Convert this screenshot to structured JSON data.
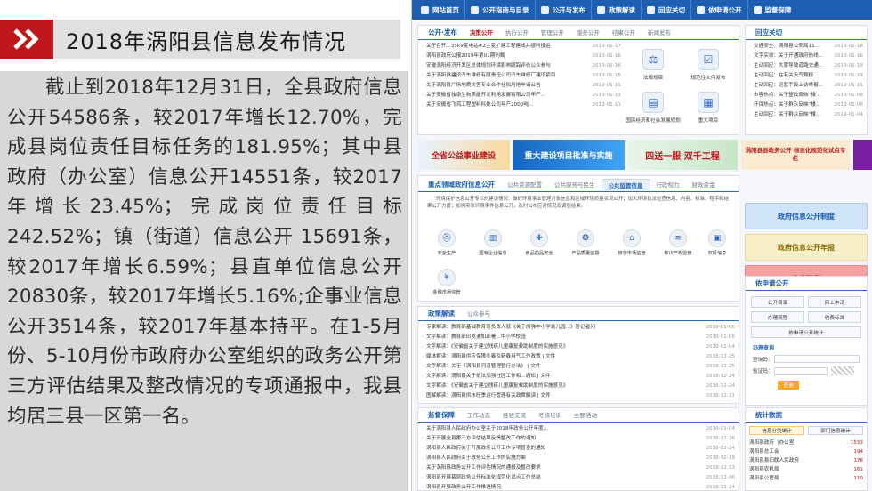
{
  "slide": {
    "title": "2018年涡阳县信息发布情况",
    "body": "截止到2018年12月31日，全县政府信息公开54586条，较2017年增长12.70%，完成县岗位责任目标任务的181.95%；其中县政府（办公室）信息公开14551条，较2017年增长23.45%；完成岗位责任目标242.52%；镇（街道）信息公开 15691条，较2017年增长6.59%；县直单位信息公开20830条，较2017年增长5.16%;企事业信息公开3514条，较2017年基本持平。在1-5月份、5-10月份市政府办公室组织的政务公开第三方评估结果及整改情况的专项通报中，我县均居三县一区第一名。"
  },
  "web": {
    "nav": [
      "网站首页",
      "公开指南与目录",
      "公开与发布",
      "政策解读",
      "回应关切",
      "依申请公开",
      "监督保障"
    ],
    "publish": {
      "tabs": [
        "公开·发布",
        "决策公开",
        "执行公开",
        "管理公开",
        "服务公开",
        "结果公开",
        "新闻发布"
      ],
      "items": [
        {
          "t": "关于召开...35kV变电站#2主变扩建工程建成并顺利投运",
          "d": "2019-01-17"
        },
        {
          "t": "涡阳县政府公报2019年第01期刊载",
          "d": "2019-01-16"
        },
        {
          "t": "安徽涡阳经济开发区总体规划环境影响跟踪评价公众参与",
          "d": "2019-01-16"
        },
        {
          "t": "关于涡阳县建设汽车维修有限责任公司汽车维修厂建设项目",
          "d": "2019-01-15"
        },
        {
          "t": "关于涡阳县广场地质灾害专业合作社拟用地申请公告",
          "d": "2019-01-11"
        },
        {
          "t": "关于安徽省独墩生物质能开发利用发展有限公司年产...",
          "d": "2019-01-11"
        },
        {
          "t": "关于安徽省飞鸿工程塑料科技公司年产2000吨...",
          "d": "2019-01-11"
        }
      ],
      "icons": [
        "法规规章",
        "规范性文件发布",
        "国民经济和社会发展规划",
        "重大项目"
      ]
    },
    "respond": {
      "title": "回应关切",
      "items": [
        {
          "t": "交通安全：涡阳县公安局11...",
          "d": "2019-01-18"
        },
        {
          "t": "文字实录：关于开通政府热线...",
          "d": "2019-01-16"
        },
        {
          "t": "主动回应：大雾导致道路交通...",
          "d": "2019-01-13"
        },
        {
          "t": "主动回应：在有关天气预报...",
          "d": "2019-01-13"
        },
        {
          "t": "主动回应：运营手段上访举报...",
          "d": "2019-01-11"
        },
        {
          "t": "市容热点：关于整改反映“楼...",
          "d": "2019-01-08"
        },
        {
          "t": "环保热点：关于群众反映“楼...",
          "d": "2019-01-08"
        },
        {
          "t": "主动回应：关于群众反映“楼...",
          "d": "2019-01-04"
        }
      ]
    },
    "banners": [
      "全省公益事业建设",
      "重大建设项目批准与实施",
      "四送一服 双千工程",
      "涡阳县县政务公开 标准化规范化试点专栏"
    ],
    "focus": {
      "tabs": [
        "重点领域政府信息公开",
        "公共资源配置",
        "公共服务与民生",
        "公共监管信息",
        "行政权力",
        "财政资金"
      ],
      "desc": "环境保护信息公开专栏的建设情况：做好环境事业管理对象信息和区域环境质量状况公开，加大环境执法检查信息、内容、标准、程序和结果公开力度；加强突发环境事件信息公开，及时公布应对情况及调查结果。",
      "services": [
        "安全生产",
        "国有企业信息",
        "食品药品安全",
        "产品质量监督",
        "旅游市场监管",
        "知识产权监管",
        "双打信息",
        "金融市场监管"
      ]
    },
    "policy": {
      "tabs": [
        "政策解读",
        "公众参与"
      ],
      "items": [
        {
          "t": "专家解读：教育部基础教育司负责人就《关于加强中小学幼儿园...》答记者问",
          "d": "2019-01-06"
        },
        {
          "t": "文字解读：教育部印发通知部署...中小学校园",
          "d": "2019-01-06"
        },
        {
          "t": "文字解读：《安徽省关于建立残疾儿童康复救助制度的实施意见》",
          "d": "2019-01-04"
        },
        {
          "t": "媒体解读：涡阳县供应保障冬春及新春用气工作政策 | 文件",
          "d": "2018-12-25"
        },
        {
          "t": "文字解读：关于《涡阳县河道管理暂行办法》 | 文件",
          "d": "2018-12-25"
        },
        {
          "t": "文字解读：涡阳县关于依法加强社区工作和...通知 | 文件",
          "d": "2018-12-24"
        },
        {
          "t": "文字解读：《安徽省关于建立残疾儿童康复救助制度的实施意见》",
          "d": "2018-12-24"
        },
        {
          "t": "图解解读：涡阳县供水旺季运行管理有关政策解读 | 文件",
          "d": "2018-12-21"
        }
      ]
    },
    "supervise": {
      "tabs": [
        "监督保障",
        "工作动态",
        "经验交流",
        "考核培训",
        "主题活动"
      ],
      "items": [
        {
          "t": "关于涡阳县人民政府办公室关于2018年政务公开年度...",
          "d": "2019-01-04"
        },
        {
          "t": "关于开展全县第三方评估结果反馈整改工作的通知",
          "d": "2018-12-26"
        },
        {
          "t": "涡阳县人民政府关于开展政务公开工作专项督查的通知",
          "d": "2018-12-24"
        },
        {
          "t": "涡阳县人民政府关于政务公开工作的实施方案",
          "d": "2018-12-19"
        },
        {
          "t": "关于涡阳县政务公开工作评估情况的通报及整改要求",
          "d": "2018-12-13"
        },
        {
          "t": "涡阳县开展基层政务公开标准化规范化试点工作总结",
          "d": "2018-12-06"
        },
        {
          "t": "涡阳县开展政务公开工作推进情况",
          "d": "2018-11-24"
        }
      ]
    },
    "side_buttons": [
      "政府信息公开制度",
      "政府信息公开年报",
      "政府指南"
    ],
    "apply": {
      "title": "依申请公开",
      "buttons": [
        "公开目录",
        "网上申请",
        "办理流程",
        "收费标准",
        "依申请公开统计"
      ],
      "query_title": "办理查询",
      "query_label": "查询码：",
      "verify_label": "验证码：",
      "query_btn": "查询"
    },
    "stats": {
      "title": "统计数据",
      "tabs": [
        "信息分类统计",
        "部门信息统计"
      ],
      "rows": [
        {
          "name": "涡阳县政府（办公室）",
          "n": "1533"
        },
        {
          "name": "涡阳县总工会",
          "n": "194"
        },
        {
          "name": "涡阳县县妇联人民政府",
          "n": "178"
        },
        {
          "name": "涡阳县农机局",
          "n": "161"
        },
        {
          "name": "涡阳县公管局",
          "n": "110"
        }
      ]
    }
  }
}
